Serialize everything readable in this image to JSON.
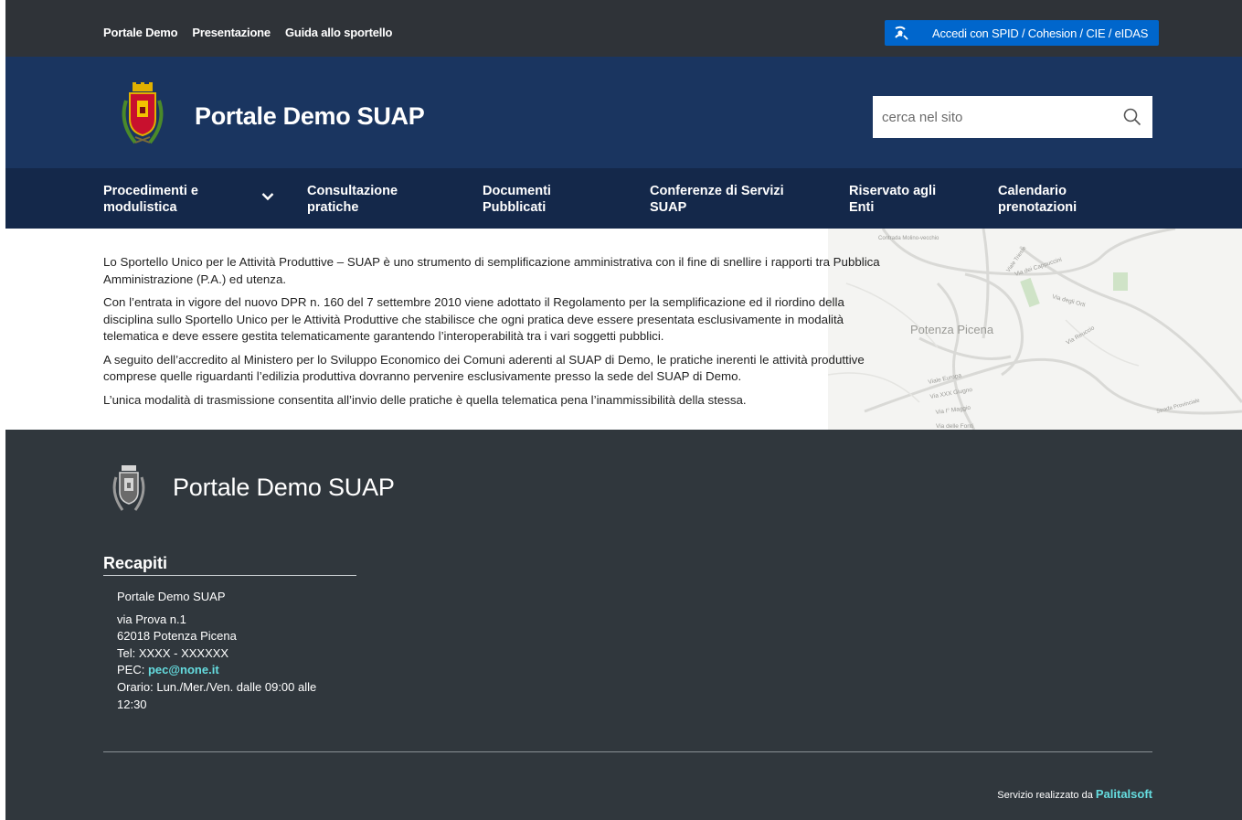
{
  "topbar": {
    "links": [
      "Portale Demo",
      "Presentazione",
      "Guida allo sportello"
    ],
    "login_label": "Accedi con SPID / Cohesion / CIE / eIDAS",
    "login_icon": "spid-user-icon",
    "login_color": "#0066cc"
  },
  "header": {
    "title": "Portale Demo SUAP",
    "logo": "coat-of-arms-icon",
    "search_placeholder": "cerca nel sito",
    "search_icon": "search-icon",
    "bg_color": "#1a3560"
  },
  "nav": {
    "items": [
      {
        "label_line1": "Procedimenti e",
        "label_line2": "modulistica",
        "has_dropdown": true
      },
      {
        "label_line1": "Consultazione",
        "label_line2": "pratiche"
      },
      {
        "label_line1": "Documenti",
        "label_line2": "Pubblicati"
      },
      {
        "label_line1": "Conferenze di Servizi",
        "label_line2": "SUAP"
      },
      {
        "label_line1": "Riservato agli",
        "label_line2": "Enti"
      },
      {
        "label_line1": "Calendario",
        "label_line2": "prenotazioni"
      }
    ],
    "bg_color": "#14284a"
  },
  "content": {
    "paragraphs": [
      "Lo Sportello Unico per le Attività Produttive – SUAP è uno strumento di semplificazione amministrativa con il fine di snellire i rapporti tra Pubblica Amministrazione (P.A.) ed utenza.",
      "Con l’entrata in vigore del nuovo DPR n. 160 del 7 settembre 2010 viene adottato il Regolamento per la semplificazione ed il riordino della disciplina sullo Sportello Unico per le Attività Produttive che stabilisce che ogni pratica deve essere presentata esclusivamente in modalità telematica e deve essere gestita telematicamente garantendo l’interoperabilità tra i vari soggetti pubblici.",
      "A seguito dell’accredito al Ministero per lo Sviluppo Economico dei Comuni aderenti al SUAP di Demo, le pratiche inerenti le attività produttive comprese quelle riguardanti l’edilizia produttiva dovranno pervenire esclusivamente presso la sede del SUAP di Demo.",
      "L’unica modalità di trasmissione consentita all’invio delle pratiche è quella telematica pena l’inammissibilità della stessa."
    ],
    "map_labels": {
      "town": "Potenza Picena",
      "streets": [
        "Contrada Molino-vecchio",
        "Via dei Cappuccini",
        "Via degli Orti",
        "Via Reuccio",
        "Viale Europa",
        "Via XXX Giugno",
        "Via I° Maggio",
        "Strada Provinciale",
        "Via delle Fonti",
        "Viale Trieste"
      ]
    }
  },
  "footer": {
    "title": "Portale Demo SUAP",
    "contacts_heading": "Recapiti",
    "org_name": "Portale Demo SUAP",
    "address1": "via Prova n.1",
    "address2": "62018 Potenza Picena",
    "tel": "Tel: XXXX - XXXXXX",
    "pec_label": "PEC: ",
    "pec_email": "pec@none.it",
    "hours_line1": "Orario: Lun./Mer./Ven. dalle 09:00 alle",
    "hours_line2": "12:30",
    "credit_prefix": "Servizio realizzato da ",
    "credit_company": "Palitalsoft",
    "bg_color": "#30373d",
    "accent_color": "#65dcdf"
  }
}
